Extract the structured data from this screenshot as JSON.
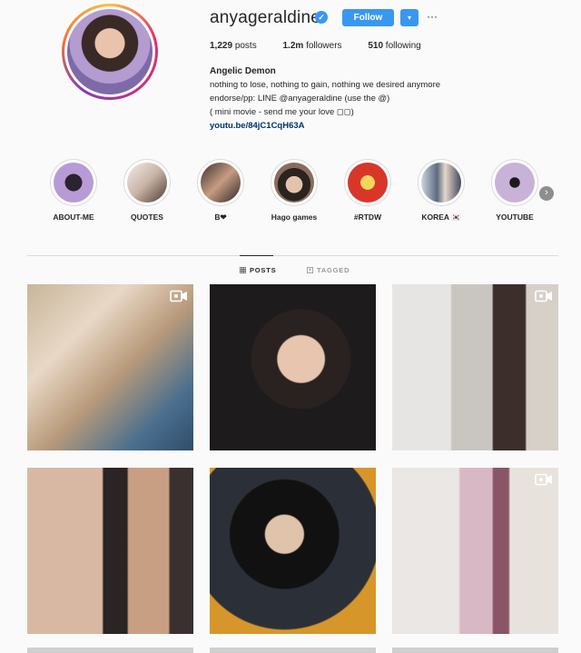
{
  "profile": {
    "username": "anyageraldine",
    "follow_label": "Follow",
    "dropdown_glyph": "▾",
    "more_glyph": "···",
    "verified_glyph": "✓",
    "stats": {
      "posts_count": "1,229",
      "posts_label": "posts",
      "followers_count": "1.2m",
      "followers_label": "followers",
      "following_count": "510",
      "following_label": "following"
    },
    "bio": {
      "name": "Angelic Demon",
      "line1": "nothing to lose, nothing to gain, nothing we desired anymore",
      "line2": "endorse/pp: LINE @anyageraldine (use the @)",
      "line3": "( mini movie - send me your love ◻◻)",
      "link": "youtu.be/84jC1CqH63A"
    }
  },
  "highlights": [
    {
      "label": "ABOUT-ME"
    },
    {
      "label": "QUOTES"
    },
    {
      "label": "B❤"
    },
    {
      "label": "Hago games"
    },
    {
      "label": "#RTDW"
    },
    {
      "label": "KOREA 🇰🇷"
    },
    {
      "label": "YOUTUBE"
    }
  ],
  "highlight_next_glyph": "›",
  "tabs": {
    "posts": "POSTS",
    "tagged": "TAGGED"
  },
  "colors": {
    "accent": "#3897f0",
    "link": "#003569",
    "background": "#fafafa"
  }
}
